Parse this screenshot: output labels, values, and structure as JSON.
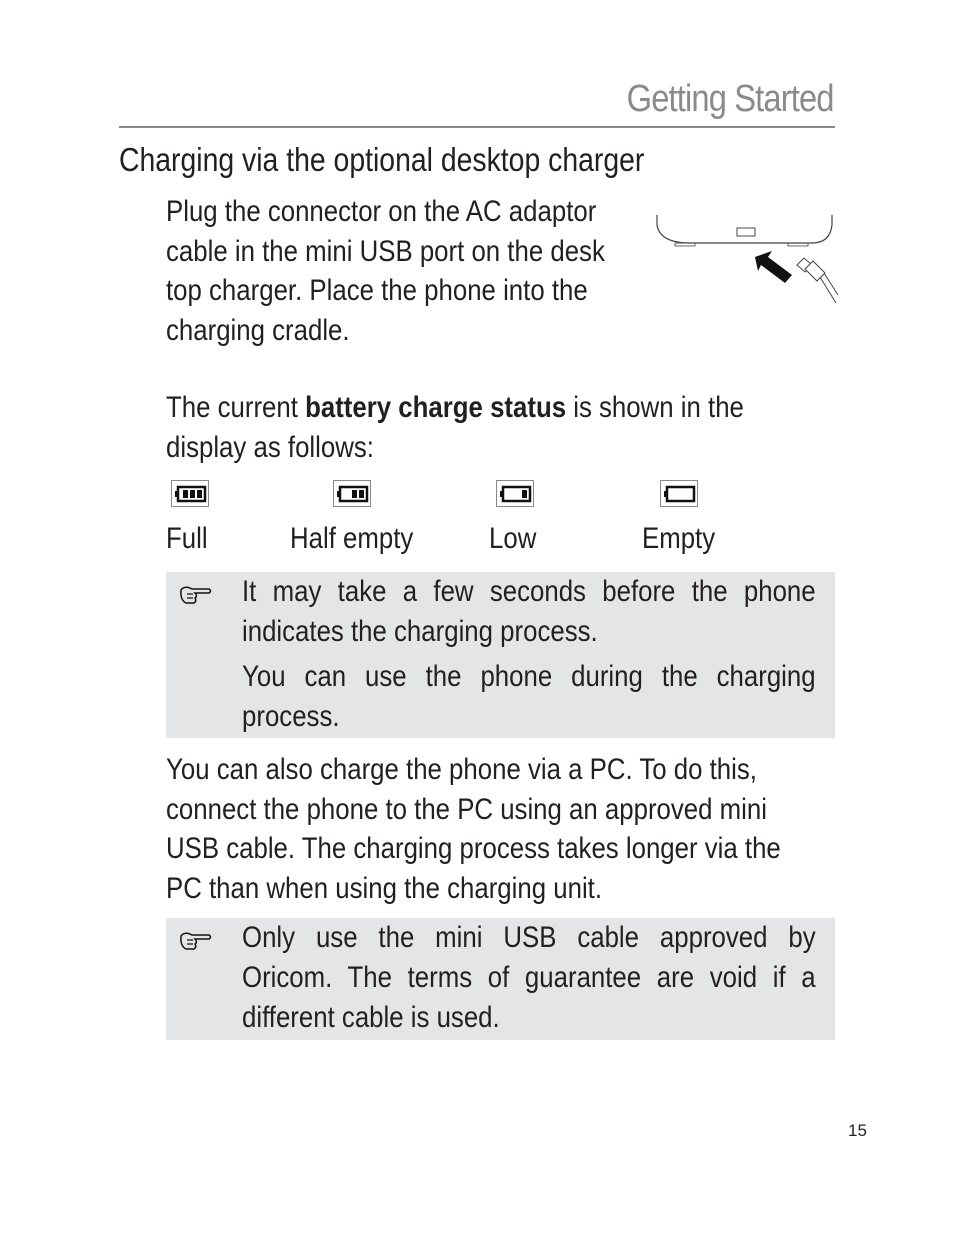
{
  "header": {
    "section_title": "Getting Started"
  },
  "heading": "Charging via the optional desktop charger",
  "paragraphs": {
    "p1": [
      "Plug the connector on the AC adaptor",
      "cable in the mini USB port on the desk",
      "top charger. Place the phone into the",
      "charging cradle."
    ],
    "p2_prefix": "The current ",
    "p2_bold": "battery charge status",
    "p2_suffix": " is shown in the",
    "p2_line2": "display as follows:",
    "p3": [
      "You can also charge the phone via a PC. To do this,",
      "connect the phone to the PC using an approved mini",
      "USB cable. The charging process takes longer via the",
      "PC than when using the charging unit."
    ]
  },
  "battery_states": [
    {
      "label": "Full",
      "icon": "battery-full-icon",
      "bars": 3
    },
    {
      "label": "Half empty",
      "icon": "battery-half-icon",
      "bars": 2
    },
    {
      "label": "Low",
      "icon": "battery-low-icon",
      "bars": 1
    },
    {
      "label": "Empty",
      "icon": "battery-empty-icon",
      "bars": 0
    }
  ],
  "notes": [
    {
      "icon": "pointing-hand-icon",
      "lines": [
        "It may take a few seconds before the phone indicates the charging process.",
        "You can use the phone during the charging process."
      ]
    },
    {
      "icon": "pointing-hand-icon",
      "lines": [
        "Only use the mini USB cable approved by Oricom. The terms of guarantee are void if a different cable is used."
      ]
    }
  ],
  "page_number": "15"
}
